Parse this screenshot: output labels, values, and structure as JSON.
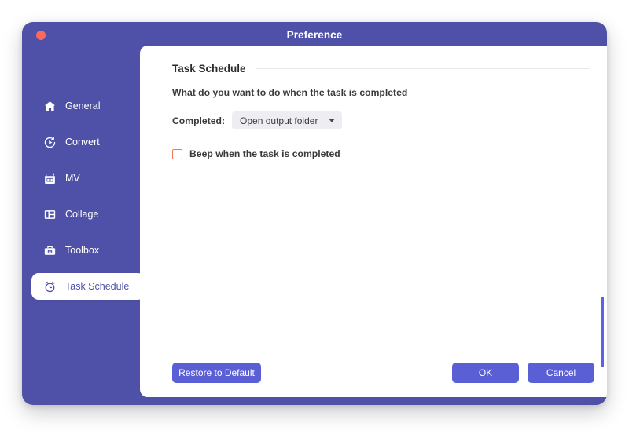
{
  "window": {
    "title": "Preference",
    "close_button": "close",
    "accent_color": "#4f51a8",
    "button_color": "#5b5fd6",
    "checkbox_color": "#f07a55",
    "scrollbar_color": "#5b63e8"
  },
  "sidebar": {
    "items": [
      {
        "label": "General",
        "icon": "home-icon",
        "active": false
      },
      {
        "label": "Convert",
        "icon": "convert-icon",
        "active": false
      },
      {
        "label": "MV",
        "icon": "mv-icon",
        "active": false
      },
      {
        "label": "Collage",
        "icon": "collage-icon",
        "active": false
      },
      {
        "label": "Toolbox",
        "icon": "toolbox-icon",
        "active": false
      },
      {
        "label": "Task Schedule",
        "icon": "alarm-clock-icon",
        "active": true
      }
    ]
  },
  "main": {
    "section_title": "Task Schedule",
    "subtitle": "What do you want to do when the task is completed",
    "completed_label": "Completed:",
    "completed_value": "Open output folder",
    "beep_checkbox_label": "Beep when the task is completed",
    "beep_checked": false
  },
  "footer": {
    "restore_label": "Restore to Default",
    "ok_label": "OK",
    "cancel_label": "Cancel"
  }
}
